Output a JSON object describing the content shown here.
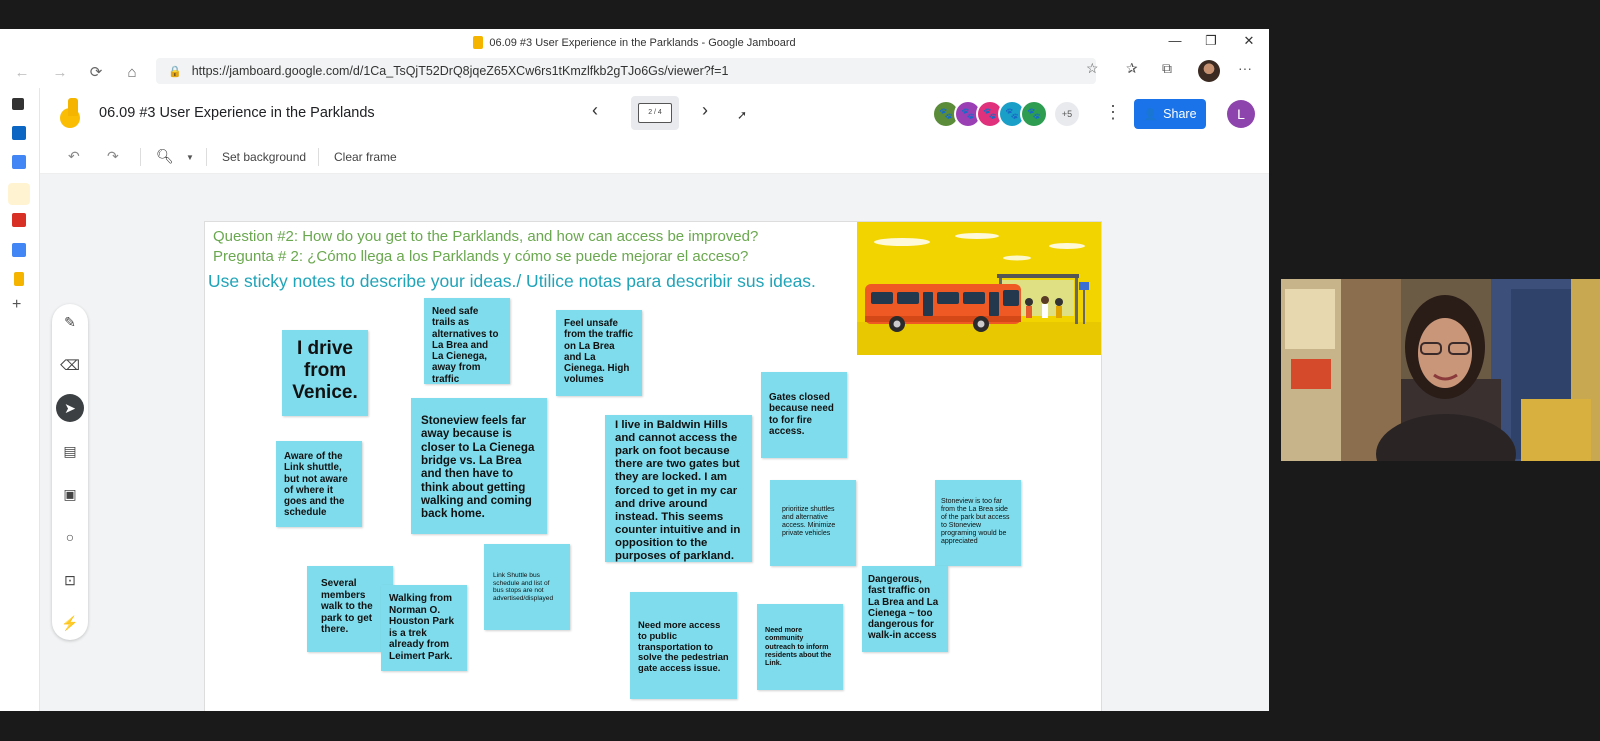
{
  "browser": {
    "window_title": "06.09 #3 User Experience in the Parklands - Google Jamboard",
    "url": "https://jamboard.google.com/d/1Ca_TsQjT52DrQ8jqeZ65XCw6rs1tKmzlfkb2gTJo6Gs/viewer?f=1",
    "controls": {
      "minimize": "—",
      "restore": "❐",
      "close": "✕"
    },
    "nav": {
      "back": "←",
      "forward": "→",
      "reload": "⟳",
      "home": "⌂"
    }
  },
  "jamboard": {
    "title": "06.09 #3 User Experience in the Parklands",
    "frame_indicator": "2 / 4",
    "more_collaborators": "+5",
    "share_label": "Share",
    "user_initial": "L",
    "toolbar": {
      "set_background": "Set background",
      "clear_frame": "Clear frame"
    }
  },
  "frame": {
    "question_en": "Question #2: How do you get to the Parklands, and how can access be improved?",
    "question_es": "Pregunta # 2: ¿Cómo llega a los Parklands y cómo se puede mejorar el acceso?",
    "instruction": "Use sticky notes to describe your ideas./ Utilice notas para describir sus ideas.",
    "notes": [
      "I drive from Venice.",
      "Need safe trails as alternatives to La Brea and La Cienega, away from traffic",
      "Feel unsafe from the traffic on La Brea and La Cienega. High volumes",
      "Gates closed because need to for fire access.",
      "Aware of the Link shuttle, but not aware of where it goes and the schedule",
      "Stoneview feels far away because is closer to La Cienega bridge vs. La Brea and then have to think about getting walking and coming back home.",
      "I live in Baldwin Hills and cannot access the park on foot because there are two gates but they are locked.  I am forced to get in my car and drive around instead.  This seems counter intuitive and in opposition to the purposes of parkland.",
      "prioritize shuttles and alternative access.  Minimize private vehicles",
      "Stoneview is too far from the La Brea side of the park but access to Stoneview programing would be appreciated",
      "Several members walk to the park to get there.",
      "Walking from Norman O. Houston Park is a trek already from Leimert Park.",
      "Link Shuttle bus schedule and list of bus stops are not advertised/displayed",
      "Need more access to public transportation to solve the pedestrian gate access issue.",
      "Need more community outreach to inform residents about the Link.",
      "Dangerous, fast traffic on La Brea and La Cienega ~ too dangerous for walk-in access"
    ]
  }
}
